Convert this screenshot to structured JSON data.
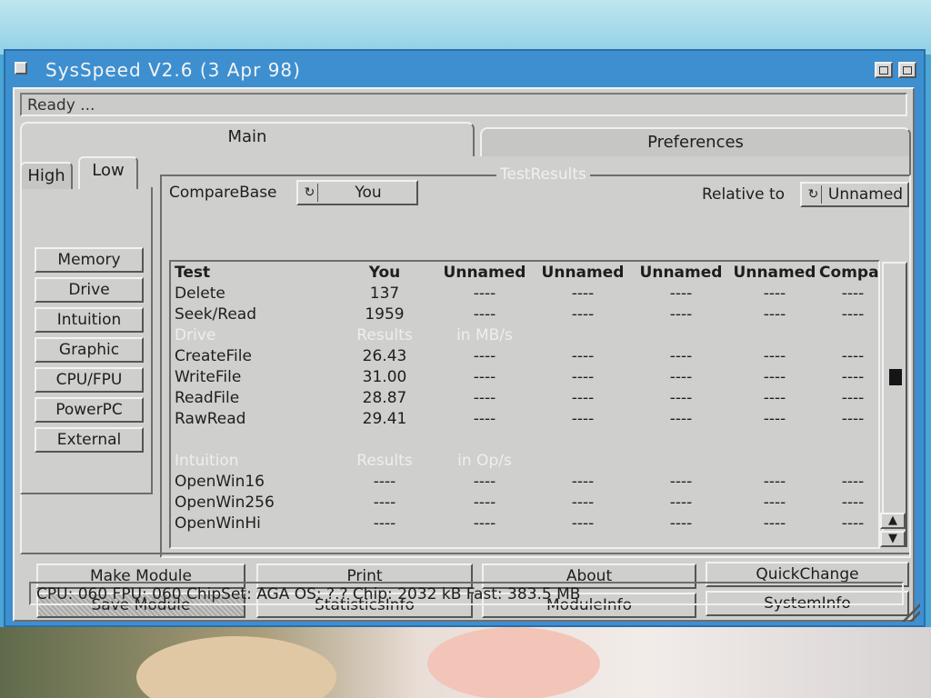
{
  "window": {
    "title": "SysSpeed  V2.6 (3 Apr 98)",
    "status": "Ready ..."
  },
  "tabs": {
    "main": "Main",
    "preferences": "Preferences"
  },
  "subtabs": {
    "high": "High",
    "low": "Low"
  },
  "side_buttons": [
    "Memory",
    "Drive",
    "Intuition",
    "Graphic",
    "CPU/FPU",
    "PowerPC",
    "External"
  ],
  "results": {
    "group_label": "TestResults",
    "compare_label": "CompareBase",
    "compare_value": "You",
    "relative_label": "Relative to",
    "relative_value": "Unnamed",
    "columns": [
      "Test",
      "You",
      "Unnamed",
      "Unnamed",
      "Unnamed",
      "Unnamed",
      "Compar"
    ],
    "rows": [
      {
        "type": "data",
        "cells": [
          "Delete",
          "137",
          "----",
          "----",
          "----",
          "----",
          "----"
        ]
      },
      {
        "type": "data",
        "cells": [
          "Seek/Read",
          "1959",
          "----",
          "----",
          "----",
          "----",
          "----"
        ]
      },
      {
        "type": "section",
        "cells": [
          "Drive",
          "Results",
          "in MB/s",
          "",
          "",
          "",
          ""
        ]
      },
      {
        "type": "data",
        "cells": [
          "CreateFile",
          "26.43",
          "----",
          "----",
          "----",
          "----",
          "----"
        ]
      },
      {
        "type": "data",
        "cells": [
          "WriteFile",
          "31.00",
          "----",
          "----",
          "----",
          "----",
          "----"
        ]
      },
      {
        "type": "data",
        "cells": [
          "ReadFile",
          "28.87",
          "----",
          "----",
          "----",
          "----",
          "----"
        ]
      },
      {
        "type": "data",
        "cells": [
          "RawRead",
          "29.41",
          "----",
          "----",
          "----",
          "----",
          "----"
        ]
      },
      {
        "type": "blank",
        "cells": [
          "",
          "",
          "",
          "",
          "",
          "",
          ""
        ]
      },
      {
        "type": "section",
        "cells": [
          "Intuition",
          "Results",
          "in Op/s",
          "",
          "",
          "",
          ""
        ]
      },
      {
        "type": "data",
        "cells": [
          "OpenWin16",
          "----",
          "----",
          "----",
          "----",
          "----",
          "----"
        ]
      },
      {
        "type": "data",
        "cells": [
          "OpenWin256",
          "----",
          "----",
          "----",
          "----",
          "----",
          "----"
        ]
      },
      {
        "type": "data",
        "cells": [
          "OpenWinHi",
          "----",
          "----",
          "----",
          "----",
          "----",
          "----"
        ]
      }
    ]
  },
  "actions": {
    "make_module": "Make Module",
    "print": "Print",
    "about": "About",
    "quickchange": "QuickChange",
    "save_module": "Save Module",
    "statistics_info": "StatisticsInfo",
    "module_info": "ModuleInfo",
    "system_info": "SystemInfo"
  },
  "info": "CPU: 060  FPU: 060  ChipSet: AGA  OS: ?.?  Chip: 2032 kB  Fast: 383.5 MB",
  "icons": {
    "cycle": "cycle-gadget-icon",
    "scroll_up": "▲",
    "scroll_down": "▼"
  }
}
